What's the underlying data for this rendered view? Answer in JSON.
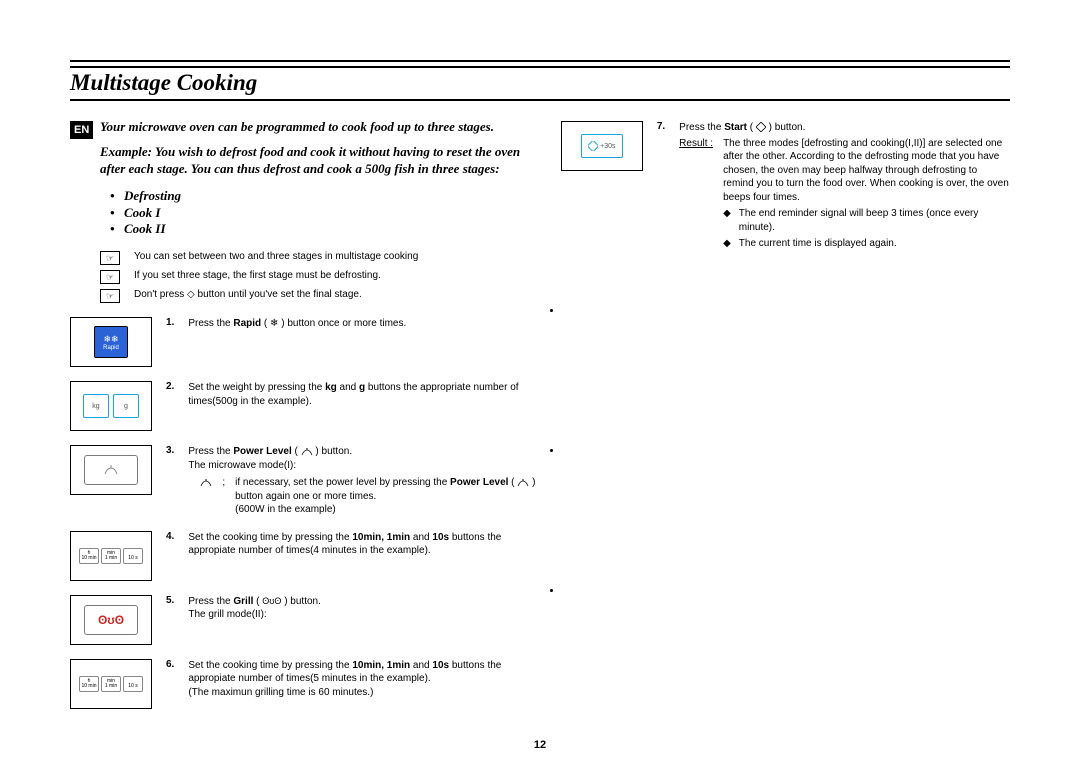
{
  "lang_badge": "EN",
  "title": "Multistage Cooking",
  "intro": "Your microwave oven can be programmed to cook food up to three stages.",
  "example": "Example: You wish to defrost food and cook it without having to reset the oven after each stage. You can thus defrost and cook a 500g fish in three stages:",
  "stages": [
    "Defrosting",
    "Cook I",
    "Cook II"
  ],
  "notes": [
    "You can set between two and three stages in multistage cooking",
    "If you set three stage, the first stage must be defrosting.",
    "Don't press ◇ button until you've set the final stage."
  ],
  "steps": {
    "s1": {
      "num": "1.",
      "pre": "Press the ",
      "bold": "Rapid",
      "post": " ( ",
      "icon": "rapid-icon",
      "tail": " ) button once or more times."
    },
    "s2": {
      "num": "2.",
      "pre": "Set the weight by pressing the ",
      "bold": "kg",
      "mid": " and ",
      "bold2": "g",
      "post": " buttons the appropriate number of times(500g in the example)."
    },
    "s3": {
      "num": "3.",
      "pre": "Press the ",
      "bold": "Power Level",
      "post": " ( ",
      "icon": "power-icon",
      "tail": " ) button.",
      "line2": "The microwave mode(I):",
      "sub_icon": "power-icon",
      "sub_sep": ";",
      "sub_text": "if necessary, set the power level by pressing the ",
      "sub_bold": "Power Level",
      "sub_text2": " ( ",
      "sub_tail": " ) button again one or more times.",
      "sub_line3": "(600W in the example)"
    },
    "s4": {
      "num": "4.",
      "pre": "Set the cooking time by pressing the ",
      "bold": "10min, 1min",
      "mid": " and ",
      "bold2": "10s",
      "post": " buttons the appropiate number of times(4 minutes in the example)."
    },
    "s5": {
      "num": "5.",
      "pre": "Press the ",
      "bold": "Grill",
      "post": " ( ",
      "icon": "grill-icon",
      "tail": " ) button.",
      "line2": "The grill mode(II):"
    },
    "s6": {
      "num": "6.",
      "pre": "Set the cooking time by pressing the ",
      "bold": "10min, 1min",
      "mid": " and ",
      "bold2": "10s",
      "post": " buttons the appropiate number of times(5 minutes in the example).",
      "line2": "(The maximun grilling time is 60 minutes.)"
    },
    "s7": {
      "num": "7.",
      "pre": "Press the ",
      "bold": "Start",
      "post": " ( ",
      "icon": "start-icon",
      "tail": " ) button.",
      "result_label": "Result :",
      "result_text": "The three modes [defrosting and cooking(I,II)] are selected one after the other. According to the defrosting mode that you have chosen, the oven may beep halfway through defrosting to remind you to turn the food over. When cooking is over, the oven beeps four times.",
      "bullets": [
        "The end reminder signal will beep 3 times (once every minute).",
        "The current time is displayed again."
      ]
    }
  },
  "icon_labels": {
    "rapid": "Rapid",
    "kg": "kg",
    "g": "g",
    "plus30": "+30s",
    "h": "h",
    "min": "min",
    "ten": "10 min",
    "one": "1 min",
    "tens": "10 s"
  },
  "page_number": "12"
}
